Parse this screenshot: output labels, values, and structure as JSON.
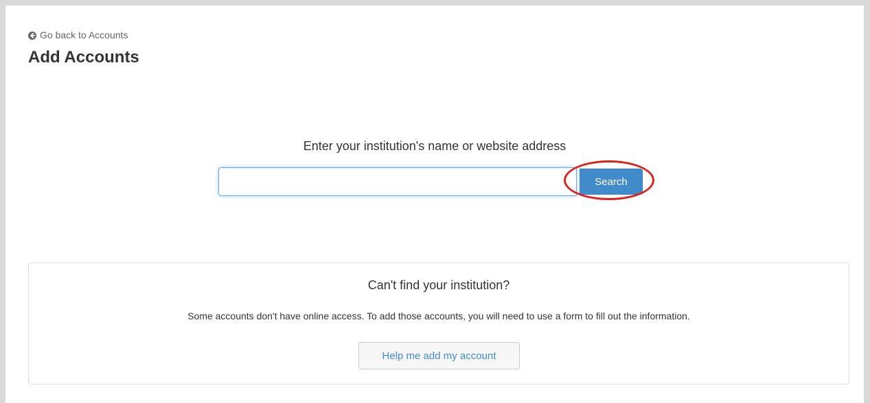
{
  "nav": {
    "back_label": "Go back to Accounts"
  },
  "header": {
    "title": "Add Accounts"
  },
  "search": {
    "prompt": "Enter your institution's name or website address",
    "value": "",
    "button_label": "Search"
  },
  "help": {
    "title": "Can't find your institution?",
    "text": "Some accounts don't have online access. To add those accounts, you will need to use a form to fill out the information.",
    "button_label": "Help me add my account"
  },
  "colors": {
    "primary": "#428bca",
    "highlight": "#e0201b"
  },
  "icons": {
    "back": "arrow-circle-left-icon"
  }
}
